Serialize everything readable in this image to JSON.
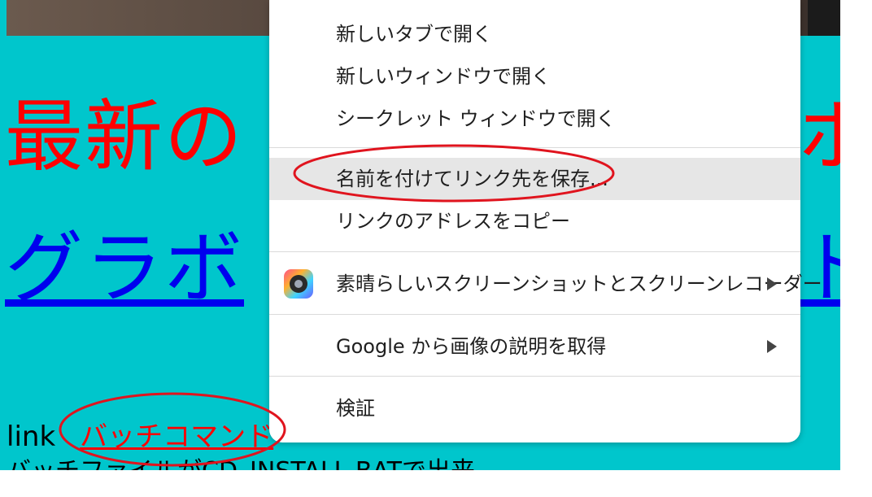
{
  "page": {
    "heading_red": "最新の",
    "heading_red_tail": "ホ",
    "heading_blue": "グラボ",
    "heading_blue_tail": "ト",
    "link_label": "link",
    "batch_link": "バッチコマンド",
    "cut_line": "バッチファイルがCD_INSTALL.BATで出来"
  },
  "context_menu": {
    "items": [
      {
        "label": "新しいタブで開く"
      },
      {
        "label": "新しいウィンドウで開く"
      },
      {
        "label": "シークレット ウィンドウで開く"
      },
      {
        "label": "名前を付けてリンク先を保存..."
      },
      {
        "label": "リンクのアドレスをコピー"
      },
      {
        "label": "素晴らしいスクリーンショットとスクリーンレコーダー",
        "icon": "screenshot-extension-icon",
        "submenu": true
      },
      {
        "label": "Google から画像の説明を取得",
        "submenu": true
      },
      {
        "label": "検証"
      }
    ]
  },
  "colors": {
    "page_background": "#00c6cc",
    "heading_red": "#ff0000",
    "heading_blue": "#0000ee",
    "menu_hover": "#e6e6e6",
    "annotation_ellipse": "#e0141e"
  }
}
